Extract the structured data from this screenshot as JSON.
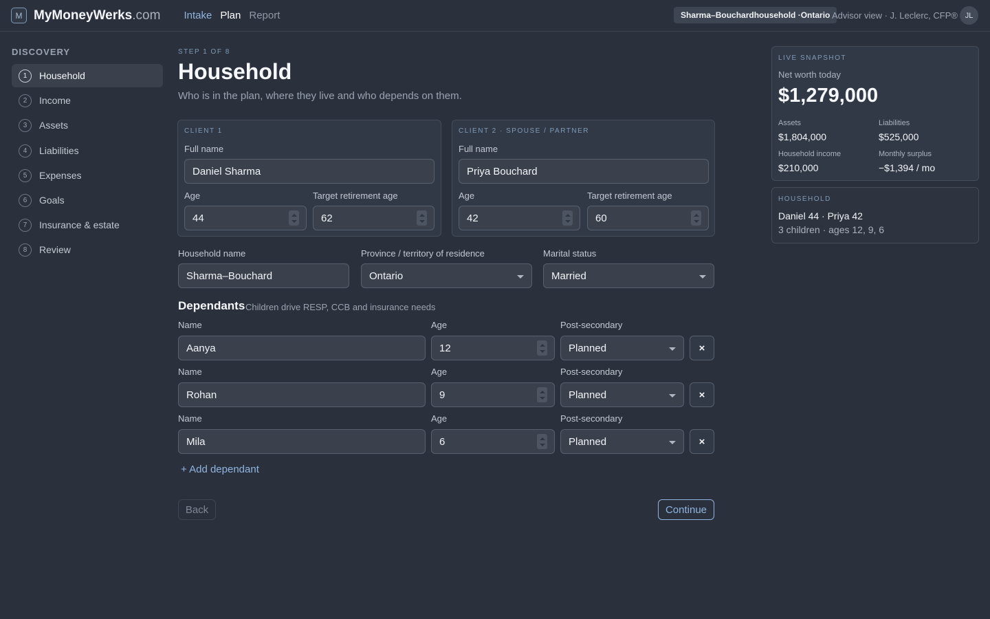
{
  "header": {
    "logo_letter": "M",
    "brand": "MyMoneyWerks",
    "brand_domain": ".com",
    "nav": [
      "Intake",
      "Plan",
      "Report"
    ],
    "household_badge": "Sharma–Bouchardhousehold ·Ontario",
    "advisor": "Advisor view · J. Leclerc, CFP®",
    "avatar_initials": "JL"
  },
  "sidebar": {
    "heading": "DISCOVERY",
    "items": [
      {
        "num": "1",
        "label": "Household"
      },
      {
        "num": "2",
        "label": "Income"
      },
      {
        "num": "3",
        "label": "Assets"
      },
      {
        "num": "4",
        "label": "Liabilities"
      },
      {
        "num": "5",
        "label": "Expenses"
      },
      {
        "num": "6",
        "label": "Goals"
      },
      {
        "num": "7",
        "label": "Insurance & estate"
      },
      {
        "num": "8",
        "label": "Review"
      }
    ]
  },
  "main": {
    "step": "STEP 1 OF 8",
    "title": "Household",
    "subtitle": "Who is in the plan, where they live and who depends on them.",
    "client1": {
      "heading": "CLIENT 1",
      "name_label": "Full name",
      "name": "Daniel Sharma",
      "age_label": "Age",
      "age": "44",
      "retire_label": "Target retirement age",
      "retire_age": "62"
    },
    "client2": {
      "heading": "CLIENT 2 · SPOUSE / PARTNER",
      "name_label": "Full name",
      "name": "Priya Bouchard",
      "age_label": "Age",
      "age": "42",
      "retire_label": "Target retirement age",
      "retire_age": "60"
    },
    "household_name_label": "Household name",
    "household_name": "Sharma–Bouchard",
    "province_label": "Province / territory of residence",
    "province": "Ontario",
    "marital_label": "Marital status",
    "marital": "Married",
    "dependants_title": "Dependants",
    "dependants_sub": "Children drive RESP, CCB and insurance needs",
    "dep_labels": {
      "name": "Name",
      "age": "Age",
      "post": "Post-secondary"
    },
    "dependants": [
      {
        "name": "Aanya",
        "age": "12",
        "post": "Planned"
      },
      {
        "name": "Rohan",
        "age": "9",
        "post": "Planned"
      },
      {
        "name": "Mila",
        "age": "6",
        "post": "Planned"
      }
    ],
    "remove_glyph": "×",
    "add_dependant": "+ Add dependant",
    "back": "Back",
    "continue": "Continue"
  },
  "snapshot": {
    "heading": "LIVE SNAPSHOT",
    "net_worth_label": "Net worth today",
    "net_worth": "$1,279,000",
    "assets_label": "Assets",
    "assets": "$1,804,000",
    "liabilities_label": "Liabilities",
    "liabilities": "$525,000",
    "income_label": "Household income",
    "income": "$210,000",
    "surplus_label": "Monthly surplus",
    "surplus": "−$1,394 / mo"
  },
  "household_card": {
    "heading": "HOUSEHOLD",
    "members": "Daniel 44 · Priya 42",
    "children": "3 children · ages 12, 9, 6"
  }
}
